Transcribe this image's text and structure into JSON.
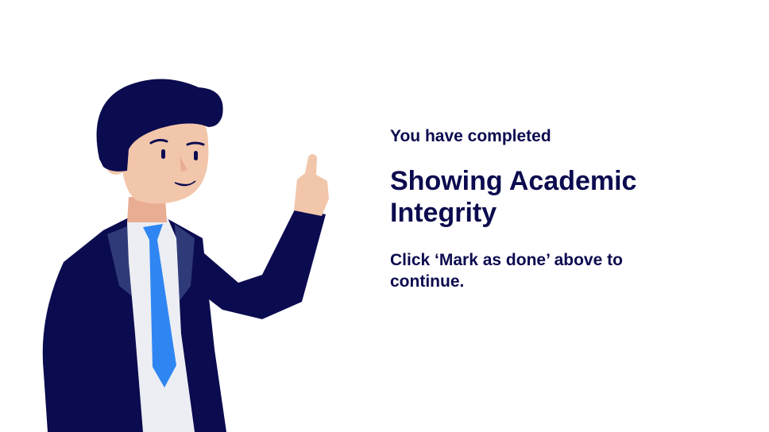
{
  "completion": {
    "label": "You have completed",
    "title": "Showing Academic Integrity",
    "instruction": "Click ‘Mark as done’ above to continue."
  },
  "illustration": {
    "icon": "pointing-man-illustration",
    "colors": {
      "hair": "#0b0b50",
      "skin": "#f2c6ab",
      "suit": "#0b0b50",
      "shirt": "#eceef3",
      "tie": "#2f86f2",
      "text": "#0c0b4f"
    }
  }
}
